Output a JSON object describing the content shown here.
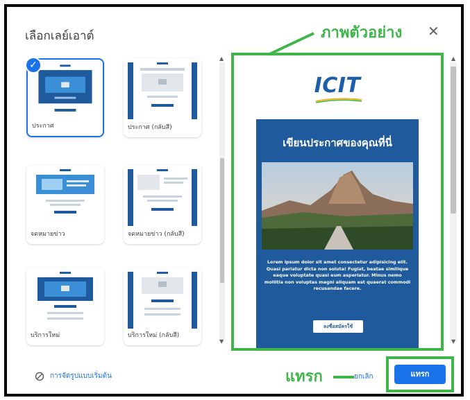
{
  "dialog": {
    "title": "เลือกเลย์เอาต์",
    "close_icon": "close-icon"
  },
  "templates": [
    {
      "label": "ประกาศ",
      "selected": true
    },
    {
      "label": "ประกาศ (กลับสี)",
      "selected": false
    },
    {
      "label": "จดหมายข่าว",
      "selected": false
    },
    {
      "label": "จดหมายข่าว (กลับสี)",
      "selected": false
    },
    {
      "label": "บริการใหม่",
      "selected": false
    },
    {
      "label": "บริการใหม่ (กลับสี)",
      "selected": false
    }
  ],
  "annotations": {
    "preview": "ภาพตัวอย่าง",
    "insert": "แทรก"
  },
  "preview": {
    "logo": "ICIT",
    "headline": "เขียนประกาศของคุณที่นี่",
    "body": "Lorem ipsum dolor sit amet consectetur adipisicing elit. Quasi pariatur dicta non soluta! Fugiat, beatae similique eaque voluptate quasi eum asperiatur. Minus nemo mollitia non voluptas magni aliquam est quaerat commodi recusandae facere.",
    "cta": "ลงชื่อสมัครใช้"
  },
  "footer": {
    "reset_link": "การจัดรูปแบบเริ่มต้น",
    "cancel": "ยกเลิก",
    "insert": "แทรก"
  },
  "colors": {
    "accent": "#1a73e8",
    "annotation_green": "#3fb54a",
    "email_blue": "#1f5a9c"
  }
}
